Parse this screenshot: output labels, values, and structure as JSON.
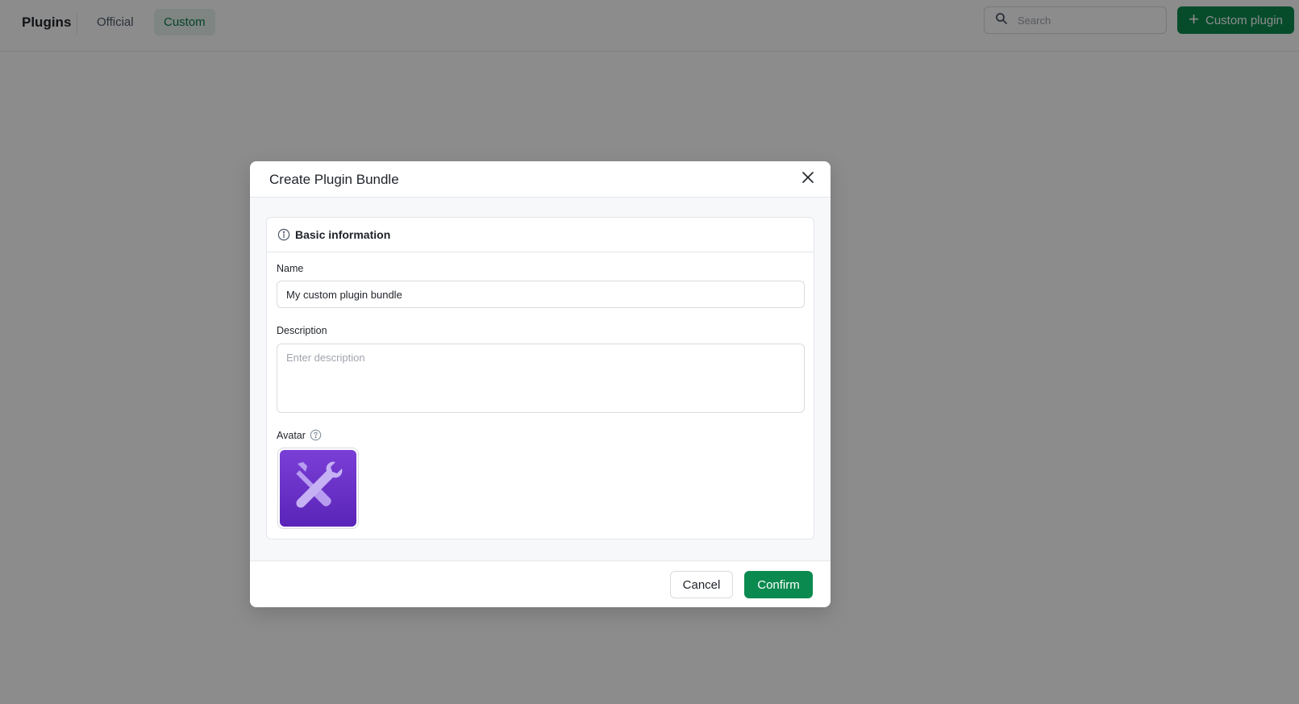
{
  "topbar": {
    "title": "Plugins",
    "tabs": [
      {
        "label": "Official",
        "active": false
      },
      {
        "label": "Custom",
        "active": true
      }
    ],
    "search": {
      "placeholder": "Search",
      "value": "",
      "icon": "search-icon"
    },
    "custom_plugin_button": {
      "label": "Custom plugin",
      "icon": "plus-icon"
    }
  },
  "modal": {
    "title": "Create Plugin Bundle",
    "close_icon": "close-icon",
    "section": {
      "title": "Basic information",
      "icon": "info-icon"
    },
    "fields": {
      "name": {
        "label": "Name",
        "value": "My custom plugin bundle"
      },
      "description": {
        "label": "Description",
        "placeholder": "Enter description",
        "value": ""
      },
      "avatar": {
        "label": "Avatar",
        "help_icon": "help-icon",
        "image_icon": "wrench-screwdriver-icon"
      }
    },
    "footer": {
      "cancel_label": "Cancel",
      "confirm_label": "Confirm"
    }
  },
  "colors": {
    "accent": "#0b8a4f",
    "active_tab_bg": "#e8f3ee",
    "avatar_bg_top": "#7a3fd6",
    "avatar_bg_bottom": "#5a24b8",
    "overlay": "rgba(0,0,0,0.45)"
  }
}
